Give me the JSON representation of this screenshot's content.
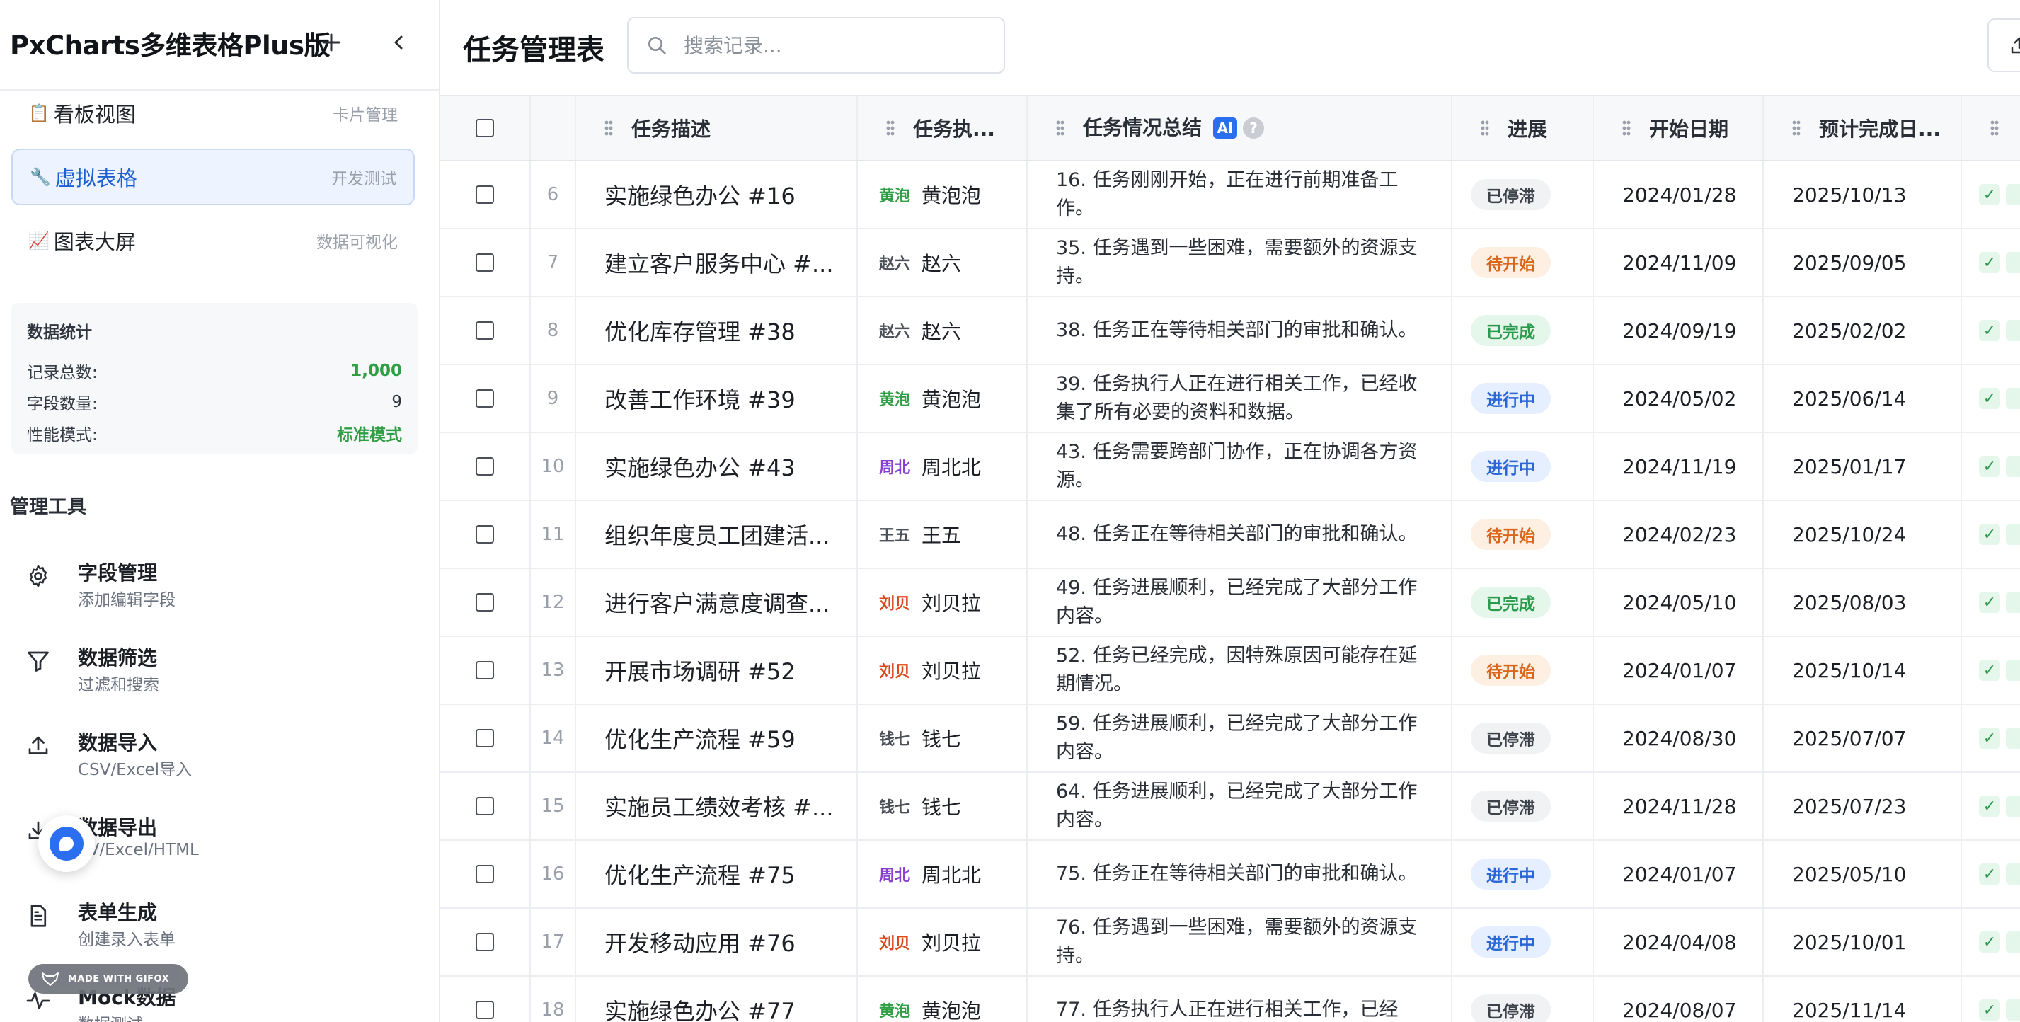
{
  "app": {
    "title": "PxCharts多维表格Plus版"
  },
  "views": [
    {
      "emoji": "📋",
      "name": "看板视图",
      "sub": "卡片管理"
    },
    {
      "emoji": "🔧",
      "name": "虚拟表格",
      "sub": "开发测试"
    },
    {
      "emoji": "📈",
      "name": "图表大屏",
      "sub": "数据可视化"
    }
  ],
  "stats": {
    "title": "数据统计",
    "rows": [
      {
        "label": "记录总数:",
        "value": "1,000"
      },
      {
        "label": "字段数量:",
        "value": "9"
      },
      {
        "label": "性能模式:",
        "value": "标准模式"
      }
    ]
  },
  "tools": {
    "title": "管理工具",
    "items": [
      {
        "icon": "gear-icon",
        "name": "字段管理",
        "sub": "添加编辑字段"
      },
      {
        "icon": "filter-icon",
        "name": "数据筛选",
        "sub": "过滤和搜索"
      },
      {
        "icon": "upload-icon",
        "name": "数据导入",
        "sub": "CSV/Excel导入"
      },
      {
        "icon": "download-icon",
        "name": "数据导出",
        "sub": "SV/Excel/HTML"
      },
      {
        "icon": "document-icon",
        "name": "表单生成",
        "sub": "创建录入表单"
      },
      {
        "icon": "activity-icon",
        "name": "Mock数据",
        "sub": "数据测试"
      }
    ]
  },
  "watermark": "MADE WITH GIFOX",
  "main": {
    "title": "任务管理表",
    "search_placeholder": "搜索记录..."
  },
  "table": {
    "headers": {
      "desc": "任务描述",
      "owner": "任务执...",
      "summary": "任务情况总结",
      "ai": "AI",
      "help": "?",
      "progress": "进展",
      "start": "开始日期",
      "due": "预计完成日..."
    },
    "rows": [
      {
        "idx": "6",
        "desc": "实施绿色办公 #16",
        "avatar": "黄泡",
        "owner": "黄泡泡",
        "summary": "16. 任务刚刚开始，正在进行前期准备工作。",
        "status": "已停滞",
        "start": "2024/01/28",
        "due": "2025/10/13"
      },
      {
        "idx": "7",
        "desc": "建立客户服务中心 #...",
        "avatar": "赵六",
        "owner": "赵六",
        "summary": "35. 任务遇到一些困难，需要额外的资源支持。",
        "status": "待开始",
        "start": "2024/11/09",
        "due": "2025/09/05"
      },
      {
        "idx": "8",
        "desc": "优化库存管理 #38",
        "avatar": "赵六",
        "owner": "赵六",
        "summary": "38. 任务正在等待相关部门的审批和确认。",
        "status": "已完成",
        "start": "2024/09/19",
        "due": "2025/02/02"
      },
      {
        "idx": "9",
        "desc": "改善工作环境 #39",
        "avatar": "黄泡",
        "owner": "黄泡泡",
        "summary": "39. 任务执行人正在进行相关工作，已经收集了所有必要的资料和数据。",
        "status": "进行中",
        "start": "2024/05/02",
        "due": "2025/06/14"
      },
      {
        "idx": "10",
        "desc": "实施绿色办公 #43",
        "avatar": "周北",
        "owner": "周北北",
        "summary": "43. 任务需要跨部门协作，正在协调各方资源。",
        "status": "进行中",
        "start": "2024/11/19",
        "due": "2025/01/17"
      },
      {
        "idx": "11",
        "desc": "组织年度员工团建活...",
        "avatar": "王五",
        "owner": "王五",
        "summary": "48. 任务正在等待相关部门的审批和确认。",
        "status": "待开始",
        "start": "2024/02/23",
        "due": "2025/10/24"
      },
      {
        "idx": "12",
        "desc": "进行客户满意度调查...",
        "avatar": "刘贝",
        "owner": "刘贝拉",
        "summary": "49. 任务进展顺利，已经完成了大部分工作内容。",
        "status": "已完成",
        "start": "2024/05/10",
        "due": "2025/08/03"
      },
      {
        "idx": "13",
        "desc": "开展市场调研 #52",
        "avatar": "刘贝",
        "owner": "刘贝拉",
        "summary": "52. 任务已经完成，因特殊原因可能存在延期情况。",
        "status": "待开始",
        "start": "2024/01/07",
        "due": "2025/10/14"
      },
      {
        "idx": "14",
        "desc": "优化生产流程 #59",
        "avatar": "钱七",
        "owner": "钱七",
        "summary": "59. 任务进展顺利，已经完成了大部分工作内容。",
        "status": "已停滞",
        "start": "2024/08/30",
        "due": "2025/07/07"
      },
      {
        "idx": "15",
        "desc": "实施员工绩效考核 #...",
        "avatar": "钱七",
        "owner": "钱七",
        "summary": "64. 任务进展顺利，已经完成了大部分工作内容。",
        "status": "已停滞",
        "start": "2024/11/28",
        "due": "2025/07/23"
      },
      {
        "idx": "16",
        "desc": "优化生产流程 #75",
        "avatar": "周北",
        "owner": "周北北",
        "summary": "75. 任务正在等待相关部门的审批和确认。",
        "status": "进行中",
        "start": "2024/01/07",
        "due": "2025/05/10"
      },
      {
        "idx": "17",
        "desc": "开发移动应用 #76",
        "avatar": "刘贝",
        "owner": "刘贝拉",
        "summary": "76. 任务遇到一些困难，需要额外的资源支持。",
        "status": "进行中",
        "start": "2024/04/08",
        "due": "2025/10/01"
      },
      {
        "idx": "18",
        "desc": "实施绿色办公 #77",
        "avatar": "黄泡",
        "owner": "黄泡泡",
        "summary": "77. 任务执行人正在进行相关工作，已经",
        "status": "已停滞",
        "start": "2024/08/07",
        "due": "2025/11/14"
      }
    ]
  },
  "colors": {
    "accent": "#2b6ff0",
    "status": {
      "已停滞": "#3d424b",
      "待开始": "#d9661c",
      "已完成": "#2a9a4d",
      "进行中": "#2b66d6"
    },
    "avatars": {
      "黄泡": "#2f9e44",
      "赵六": "#4b5059",
      "周北": "#8a3fd1",
      "王五": "#4b5059",
      "刘贝": "#d9481c",
      "钱七": "#4b5059"
    }
  }
}
